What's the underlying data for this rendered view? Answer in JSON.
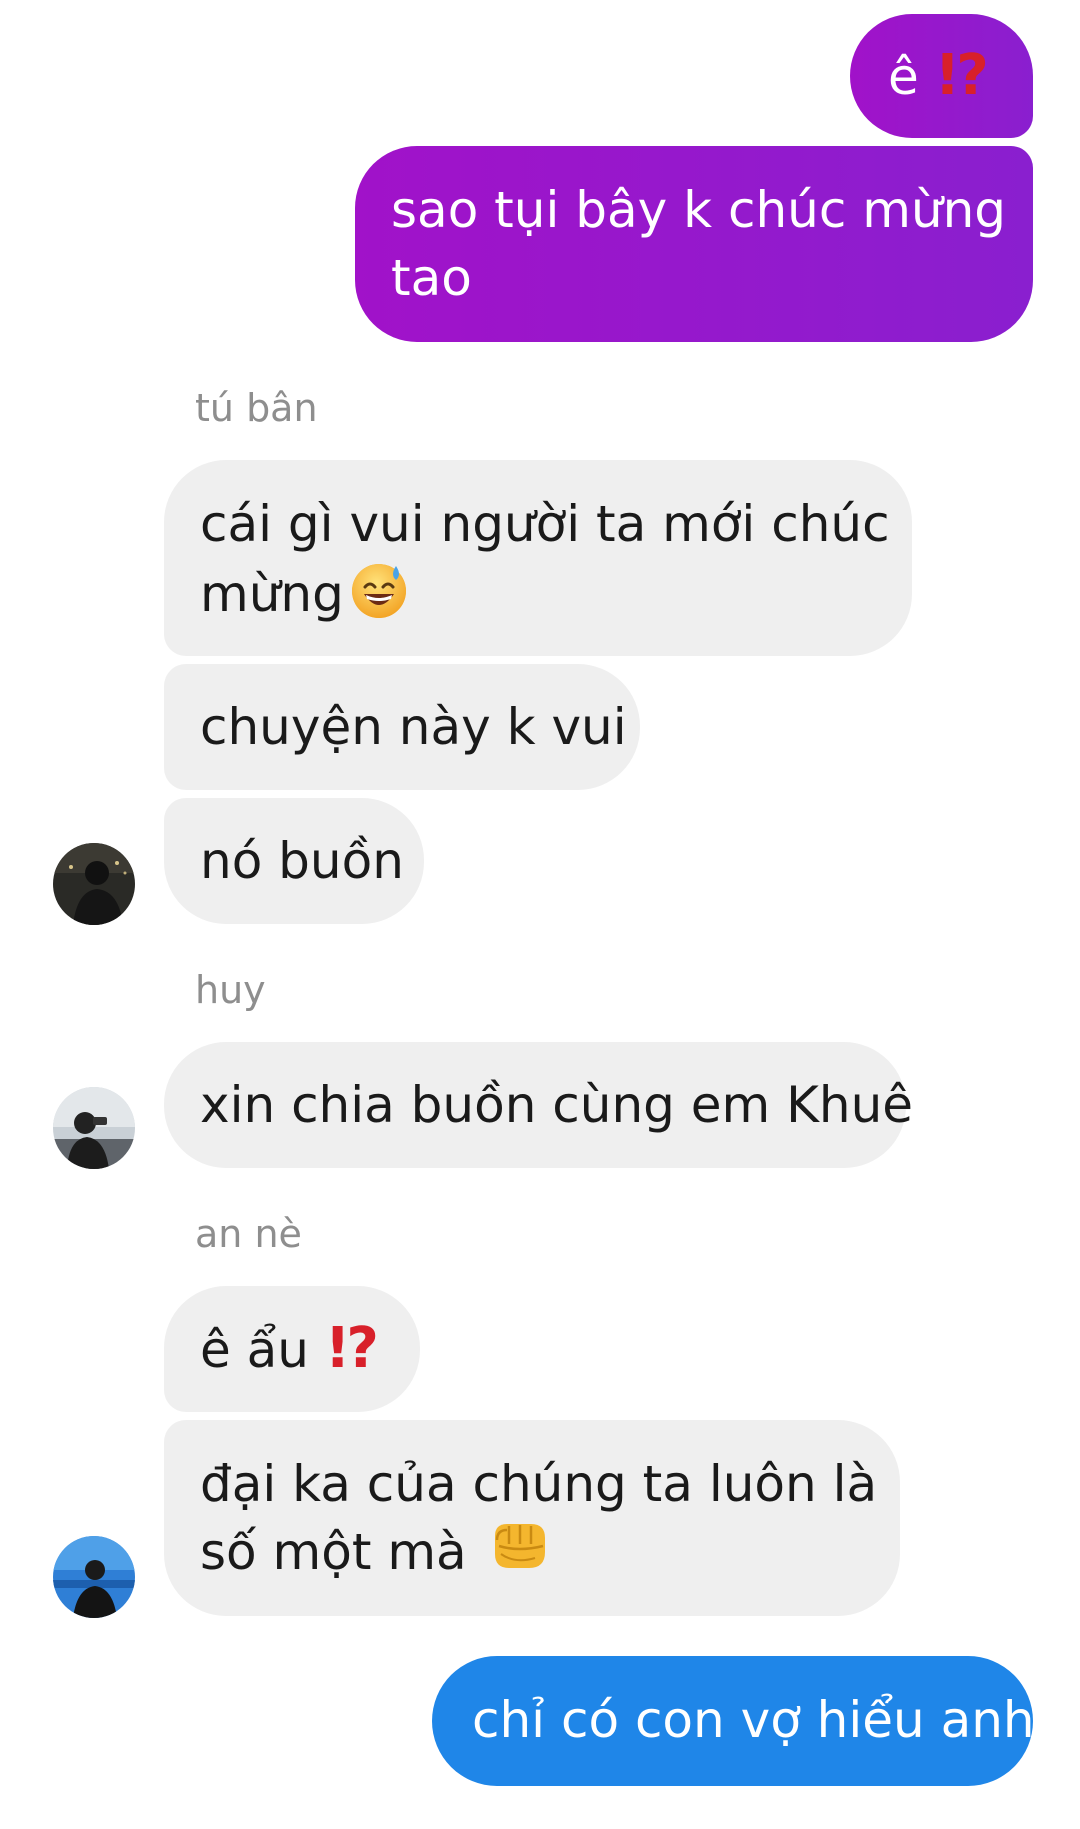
{
  "messages": {
    "m1": {
      "text": "ê",
      "emoji": "⁉️"
    },
    "m2": {
      "line1": "sao tụi bây k chúc mừng",
      "line2": "tao"
    },
    "g1": {
      "sender": "tú bân",
      "b1": {
        "line1": "cái gì vui người ta mới chúc",
        "line2": "mừng",
        "emoji": "😅"
      },
      "b2": {
        "text": "chuyện này k vui"
      },
      "b3": {
        "text": "nó buồn"
      }
    },
    "g2": {
      "sender": "huy",
      "b1": {
        "text": "xin chia buồn cùng em Khuê"
      }
    },
    "g3": {
      "sender": "an nè",
      "b1": {
        "text": "ê ẩu",
        "emoji": "⁉️"
      },
      "b2": {
        "line1": "đại ka của chúng ta luôn là",
        "line2": "số một mà",
        "emoji": "👊"
      }
    },
    "m_last": {
      "text": "chỉ có con vợ hiểu anh"
    }
  },
  "colors": {
    "outgoing_purple": "#9a17cb",
    "outgoing_blue": "#1f86e8",
    "incoming_gray": "#efefef",
    "sender_gray": "#8e8e8e",
    "exclamation_red": "#d8202a"
  },
  "icons": {
    "exclamation_question": "exclamation-question-icon",
    "sweat_smile": "sweat-smile-emoji-icon",
    "fist": "oncoming-fist-emoji-icon"
  }
}
